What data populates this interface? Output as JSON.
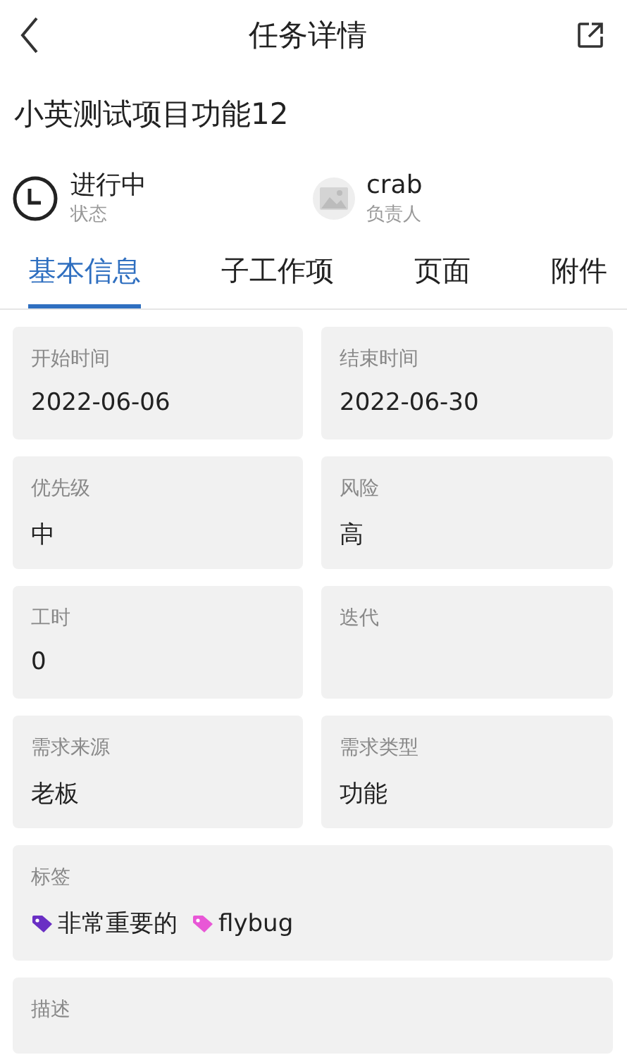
{
  "header": {
    "title": "任务详情"
  },
  "task_title": "小英测试项目功能12",
  "summary": [
    {
      "kind": "status",
      "value": "进行中",
      "label": "状态"
    },
    {
      "kind": "assignee",
      "value": "crab",
      "label": "负责人"
    }
  ],
  "tabs": [
    {
      "label": "基本信息",
      "selected": true
    },
    {
      "label": "子工作项",
      "selected": false
    },
    {
      "label": "页面",
      "selected": false
    },
    {
      "label": "附件",
      "selected": false
    }
  ],
  "fields": [
    {
      "kind": "half",
      "label": "开始时间",
      "value": "2022-06-06"
    },
    {
      "kind": "half",
      "label": "结束时间",
      "value": "2022-06-30"
    },
    {
      "kind": "half",
      "label": "优先级",
      "value": "中"
    },
    {
      "kind": "half",
      "label": "风险",
      "value": "高"
    },
    {
      "kind": "half",
      "label": "工时",
      "value": "0"
    },
    {
      "kind": "half",
      "label": "迭代"
    },
    {
      "kind": "half",
      "label": "需求来源",
      "value": "老板"
    },
    {
      "kind": "half",
      "label": "需求类型",
      "value": "功能"
    },
    {
      "kind": "tags",
      "label": "标签",
      "tags": [
        {
          "text": "非常重要的",
          "color": "#6a2fc4"
        },
        {
          "text": "flybug",
          "color": "#e857d6"
        }
      ]
    },
    {
      "kind": "cut",
      "label": "描述"
    }
  ]
}
